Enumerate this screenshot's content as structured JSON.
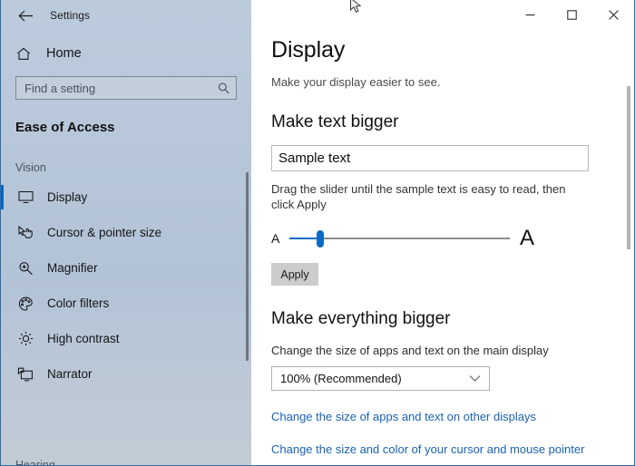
{
  "window": {
    "titlebar_label": "Settings",
    "back_icon": "back-arrow-icon",
    "controls": {
      "minimize": "minimize-icon",
      "maximize": "maximize-icon",
      "close": "close-icon"
    },
    "border_color": "#2b6ca8"
  },
  "sidebar": {
    "background_color": "#b6c6d9",
    "accent_color": "#0a67c0",
    "home": {
      "label": "Home",
      "icon": "home-icon"
    },
    "search": {
      "placeholder": "Find a setting",
      "value": "",
      "icon": "search-icon"
    },
    "section_title": "Ease of Access",
    "groups": [
      {
        "label": "Vision",
        "items": [
          {
            "label": "Display",
            "icon": "monitor-icon",
            "selected": true
          },
          {
            "label": "Cursor & pointer size",
            "icon": "cursor-pointer-icon",
            "selected": false
          },
          {
            "label": "Magnifier",
            "icon": "magnifier-icon",
            "selected": false
          },
          {
            "label": "Color filters",
            "icon": "color-palette-icon",
            "selected": false
          },
          {
            "label": "High contrast",
            "icon": "brightness-icon",
            "selected": false
          },
          {
            "label": "Narrator",
            "icon": "narrator-icon",
            "selected": false
          }
        ]
      },
      {
        "label": "Hearing",
        "items": []
      }
    ]
  },
  "main": {
    "page_title": "Display",
    "page_subtitle": "Make your display easier to see.",
    "make_text_bigger": {
      "heading": "Make text bigger",
      "sample_text": "Sample text",
      "helper_text": "Drag the slider until the sample text is easy to read, then click Apply",
      "slider": {
        "min_label": "A",
        "max_label": "A",
        "value_percent": 11,
        "fill_color": "#0a6bc4",
        "track_color": "#8c8c8c"
      },
      "apply_label": "Apply"
    },
    "make_everything_bigger": {
      "heading": "Make everything bigger",
      "field_label": "Change the size of apps and text on the main display",
      "scale_value": "100% (Recommended)",
      "chevron_icon": "chevron-down-icon"
    },
    "links": [
      {
        "text": "Change the size of apps and text on other displays"
      },
      {
        "text": "Change the size and color of your cursor and mouse pointer"
      }
    ],
    "link_color": "#1a62b0"
  }
}
